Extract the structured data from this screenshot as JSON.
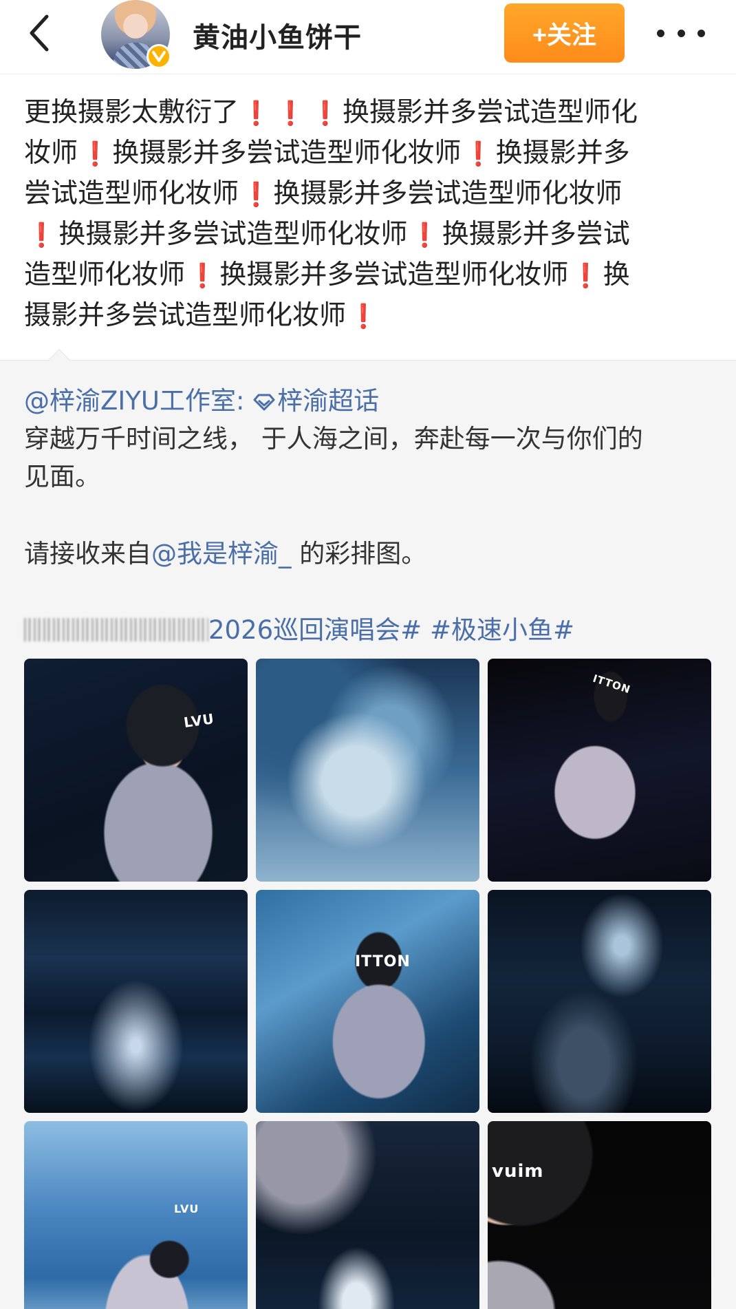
{
  "header": {
    "username": "黄油小鱼饼干",
    "follow_label": "+关注"
  },
  "post": {
    "lines": [
      [
        "更换摄影太敷衍了",
        "!",
        "!",
        "!",
        "换摄影并多尝试造型师化"
      ],
      [
        "妆师",
        "!",
        "换摄影并多尝试造型师化妆师",
        "!",
        "换摄影并多"
      ],
      [
        "尝试造型师化妆师",
        "!",
        "换摄影并多尝试造型师化妆师"
      ],
      [
        "!",
        "换摄影并多尝试造型师化妆师",
        "!",
        "换摄影并多尝试"
      ],
      [
        "造型师化妆师",
        "!",
        "换摄影并多尝试造型师化妆师",
        "!",
        "换"
      ],
      [
        "摄影并多尝试造型师化妆师",
        "!"
      ]
    ]
  },
  "repost": {
    "author_mention": "@梓渝ZIYU工作室:",
    "supertopic": "梓渝超话",
    "body_line1": "穿越万千时间之线， 于人海之间，奔赴每一次与你们的",
    "body_line2": "见面。",
    "body_line3_prefix": "请接收来自",
    "body_line3_mention": "@我是梓渝_",
    "body_line3_suffix": " 的彩排图。",
    "hashtag1": "2026巡回演唱会#",
    "hashtag2": "#极速小鱼#"
  },
  "images": {
    "labels": [
      "LVU",
      "ITTON",
      "ITTON",
      "LVU",
      "vuim"
    ]
  },
  "colors": {
    "accent_orange": "#ff9a22",
    "link_blue": "#4a6ea8",
    "exclamation_red": "#e8272b",
    "verify_gold": "#ffb300"
  }
}
